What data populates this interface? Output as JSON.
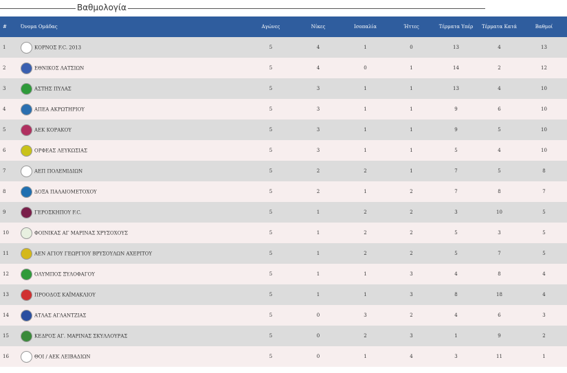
{
  "section_title": "Βαθμολογία",
  "headers": {
    "rank": "#",
    "team": "Όνομα Ομάδας",
    "played": "Αγώνες",
    "wins": "Νίκες",
    "draws": "Ισοπαλία",
    "losses": "Ήττες",
    "goals_for": "Τέρματα Υπέρ",
    "goals_against": "Τέρματα Κατά",
    "points": "Βαθμοί"
  },
  "rows": [
    {
      "rank": "1",
      "team": "ΚΟΡΝΟΣ F.C. 2013",
      "logo": "kornos-logo",
      "logo_color": "#ffffff",
      "played": "5",
      "wins": "4",
      "draws": "1",
      "losses": "0",
      "gf": "13",
      "ga": "4",
      "pts": "13"
    },
    {
      "rank": "2",
      "team": "ΕΘΝΙΚΟΣ ΛΑΤΣΙΩΝ",
      "logo": "ethnikos-logo",
      "logo_color": "#3a5fb0",
      "played": "5",
      "wins": "4",
      "draws": "0",
      "losses": "1",
      "gf": "14",
      "ga": "2",
      "pts": "12"
    },
    {
      "rank": "3",
      "team": "ΑΣΤΗΣ ΠΥΛΑΣ",
      "logo": "astis-logo",
      "logo_color": "#2f9a3a",
      "played": "5",
      "wins": "3",
      "draws": "1",
      "losses": "1",
      "gf": "13",
      "ga": "4",
      "pts": "10"
    },
    {
      "rank": "4",
      "team": "ΑΠΕΑ ΑΚΡΩΤΗΡΙΟΥ",
      "logo": "apea-logo",
      "logo_color": "#2a6fb0",
      "played": "5",
      "wins": "3",
      "draws": "1",
      "losses": "1",
      "gf": "9",
      "ga": "6",
      "pts": "10"
    },
    {
      "rank": "5",
      "team": "ΑΕΚ ΚΟΡΑΚΟΥ",
      "logo": "aek-korakou-logo",
      "logo_color": "#b03060",
      "played": "5",
      "wins": "3",
      "draws": "1",
      "losses": "1",
      "gf": "9",
      "ga": "5",
      "pts": "10"
    },
    {
      "rank": "6",
      "team": "ΟΡΦΕΑΣ ΛΕΥΚΩΣΙΑΣ",
      "logo": "orfeas-logo",
      "logo_color": "#c9c21a",
      "played": "5",
      "wins": "3",
      "draws": "1",
      "losses": "1",
      "gf": "5",
      "ga": "4",
      "pts": "10"
    },
    {
      "rank": "7",
      "team": "ΑΕΠ ΠΟΛΕΜΙΔΙΩΝ",
      "logo": "aep-logo",
      "logo_color": "#ffffff",
      "played": "5",
      "wins": "2",
      "draws": "2",
      "losses": "1",
      "gf": "7",
      "ga": "5",
      "pts": "8"
    },
    {
      "rank": "8",
      "team": "ΔΟΞΑ ΠΑΛΑΙΟΜΕΤΟΧΟΥ",
      "logo": "doxa-logo",
      "logo_color": "#1f6fb0",
      "played": "5",
      "wins": "2",
      "draws": "1",
      "losses": "2",
      "gf": "7",
      "ga": "8",
      "pts": "7"
    },
    {
      "rank": "9",
      "team": "ΓΕΡΟΣΚΗΠΟΥ F.C.",
      "logo": "geroskipou-logo",
      "logo_color": "#7a1f4a",
      "played": "5",
      "wins": "1",
      "draws": "2",
      "losses": "2",
      "gf": "3",
      "ga": "10",
      "pts": "5"
    },
    {
      "rank": "10",
      "team": "ΦΟΙΝΙΚΑΣ ΑΓ ΜΑΡΙΝΑΣ ΧΡΥΣΟΧΟΥΣ",
      "logo": "foinikas-logo",
      "logo_color": "#e8f0e0",
      "played": "5",
      "wins": "1",
      "draws": "2",
      "losses": "2",
      "gf": "5",
      "ga": "3",
      "pts": "5"
    },
    {
      "rank": "11",
      "team": "ΑΕΝ ΑΓΙΟΥ ΓΕΩΡΓΙΟΥ ΒΡΥΣΟΥΛΩΝ ΑΧΕΡΙΤΟΥ",
      "logo": "aen-logo",
      "logo_color": "#d4b81a",
      "played": "5",
      "wins": "1",
      "draws": "2",
      "losses": "2",
      "gf": "5",
      "ga": "7",
      "pts": "5"
    },
    {
      "rank": "12",
      "team": "ΟΛΥΜΠΟΣ ΞΥΛΟΦΑΓΟΥ",
      "logo": "olympos-logo",
      "logo_color": "#2f9a3a",
      "played": "5",
      "wins": "1",
      "draws": "1",
      "losses": "3",
      "gf": "4",
      "ga": "8",
      "pts": "4"
    },
    {
      "rank": "13",
      "team": "ΠΡΟΟΔΟΣ ΚΑΪΜΑΚΛΙΟΥ",
      "logo": "proodos-logo",
      "logo_color": "#d03030",
      "played": "5",
      "wins": "1",
      "draws": "1",
      "losses": "3",
      "gf": "8",
      "ga": "18",
      "pts": "4"
    },
    {
      "rank": "14",
      "team": "ΑΤΛΑΣ ΑΓΛΑΝΤΖΙΑΣ",
      "logo": "atlas-logo",
      "logo_color": "#2a4fa0",
      "played": "5",
      "wins": "0",
      "draws": "3",
      "losses": "2",
      "gf": "4",
      "ga": "6",
      "pts": "3"
    },
    {
      "rank": "15",
      "team": "ΚΕΔΡΟΣ ΑΓ. ΜΑΡΙΝΑΣ ΣΚΥΛΛΟΥΡΑΣ",
      "logo": "kedros-logo",
      "logo_color": "#3a8a3a",
      "played": "5",
      "wins": "0",
      "draws": "2",
      "losses": "3",
      "gf": "1",
      "ga": "9",
      "pts": "2"
    },
    {
      "rank": "16",
      "team": "ΘΟΙ / ΑΕΚ ΛΕΙΒΑΔΙΩΝ",
      "logo": "thoi-logo",
      "logo_color": "#ffffff",
      "played": "5",
      "wins": "0",
      "draws": "1",
      "losses": "4",
      "gf": "3",
      "ga": "11",
      "pts": "1"
    }
  ]
}
